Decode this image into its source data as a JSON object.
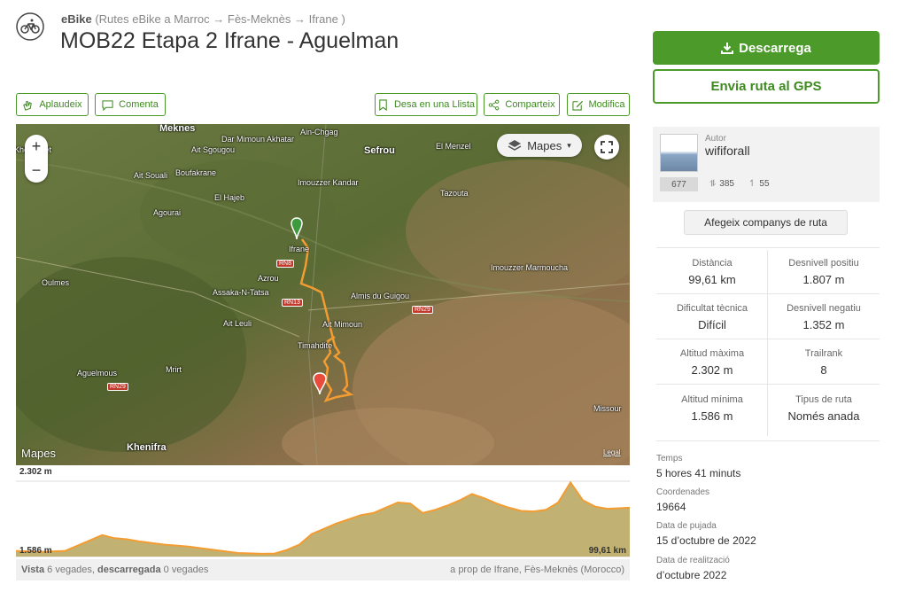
{
  "header": {
    "category": "eBike",
    "breadcrumb": "(Rutes eBike a Marroc → Fès-Meknès → Ifrane )",
    "title": "MOB22 Etapa 2 Ifrane - Aguelman"
  },
  "actions": {
    "applaud": "Aplaudeix",
    "comment": "Comenta",
    "save_list": "Desa en una Llista",
    "share": "Comparteix",
    "edit": "Modifica"
  },
  "map": {
    "type_label": "Mapes",
    "zoom_in": "+",
    "zoom_out": "−",
    "provider": "Mapes",
    "legal": "Legal",
    "labels": [
      {
        "text": "Meknes",
        "big": true
      },
      {
        "text": "Dar Mimoun Akhatar"
      },
      {
        "text": "Ain-Chgag"
      },
      {
        "text": "Sefrou",
        "big": true
      },
      {
        "text": "El Menzel"
      },
      {
        "text": "Ait Sgougou"
      },
      {
        "text": "El Hajeb"
      },
      {
        "text": "Boufakrane"
      },
      {
        "text": "Ait Souali"
      },
      {
        "text": "Agourai"
      },
      {
        "text": "Imouzzer Kandar"
      },
      {
        "text": "Tazouta"
      },
      {
        "text": "Ifrane"
      },
      {
        "text": "Azrou"
      },
      {
        "text": "Oulmes"
      },
      {
        "text": "Assaka-N-Tatsa"
      },
      {
        "text": "Almis du Guigou"
      },
      {
        "text": "Imouzzer Marmoucha"
      },
      {
        "text": "Ait Leuli"
      },
      {
        "text": "Ait Mimoun"
      },
      {
        "text": "Timahdite"
      },
      {
        "text": "Aguelmous"
      },
      {
        "text": "Mrirt"
      },
      {
        "text": "Khenifra",
        "big": true
      },
      {
        "text": "Missour"
      },
      {
        "text": "Khemisset"
      }
    ],
    "roads": [
      "RN8",
      "RN13",
      "RN29",
      "RN29"
    ]
  },
  "elevation": {
    "max_label": "2.302 m",
    "min_label": "1.586 m",
    "distance_label": "99,61 km"
  },
  "chart_data": {
    "type": "area",
    "title": "",
    "xlabel": "",
    "ylabel": "",
    "xlim": [
      0,
      99.61
    ],
    "ylim": [
      1586,
      2302
    ],
    "x": [
      0,
      4,
      8,
      10,
      14,
      16,
      18,
      20,
      24,
      28,
      32,
      36,
      40,
      42,
      44,
      46,
      48,
      52,
      54,
      56,
      58,
      60,
      62,
      64,
      66,
      68,
      70,
      72,
      74,
      76,
      78,
      80,
      82,
      84,
      86,
      88,
      90,
      92,
      94,
      96,
      99.61
    ],
    "series": [
      {
        "values": [
          1640,
          1630,
          1640,
          1690,
          1790,
          1760,
          1750,
          1730,
          1700,
          1680,
          1650,
          1620,
          1612,
          1615,
          1650,
          1700,
          1800,
          1900,
          1940,
          1980,
          2000,
          2050,
          2100,
          2090,
          2000,
          2030,
          2070,
          2120,
          2180,
          2140,
          2090,
          2050,
          2020,
          2015,
          2030,
          2100,
          2290,
          2120,
          2060,
          2040,
          2050
        ]
      }
    ]
  },
  "footer": {
    "views_label": "Vista",
    "views_value": "6 vegades,",
    "downloads_label": "descarregada",
    "downloads_value": "0 vegades",
    "location": "a prop de Ifrane, Fès-Meknès (Morocco)"
  },
  "sidebar": {
    "download": "Descarrega",
    "send_gps": "Envia ruta al GPS",
    "author_label": "Autor",
    "author_name": "wififorall",
    "author_count": "677",
    "author_followers": "385",
    "author_following": "55",
    "add_companions": "Afegeix companys de ruta",
    "stats": [
      {
        "label": "Distància",
        "value": "99,61 km"
      },
      {
        "label": "Desnivell positiu",
        "value": "1.807 m"
      },
      {
        "label": "Dificultat tècnica",
        "value": "Difícil"
      },
      {
        "label": "Desnivell negatiu",
        "value": "1.352 m"
      },
      {
        "label": "Altitud màxima",
        "value": "2.302 m"
      },
      {
        "label": "Trailrank",
        "value": "8"
      },
      {
        "label": "Altitud mínima",
        "value": "1.586 m"
      },
      {
        "label": "Tipus de ruta",
        "value": "Només anada"
      }
    ],
    "meta": [
      {
        "label": "Temps",
        "value": "5 hores 41 minuts"
      },
      {
        "label": "Coordenades",
        "value": "19664"
      },
      {
        "label": "Data de pujada",
        "value": "15 d’octubre de 2022"
      },
      {
        "label": "Data de realització",
        "value": "d’octubre 2022"
      }
    ]
  },
  "colors": {
    "brand": "#4c9a2a",
    "route": "#f39c32",
    "elevation_fill": "#b6a45a"
  }
}
